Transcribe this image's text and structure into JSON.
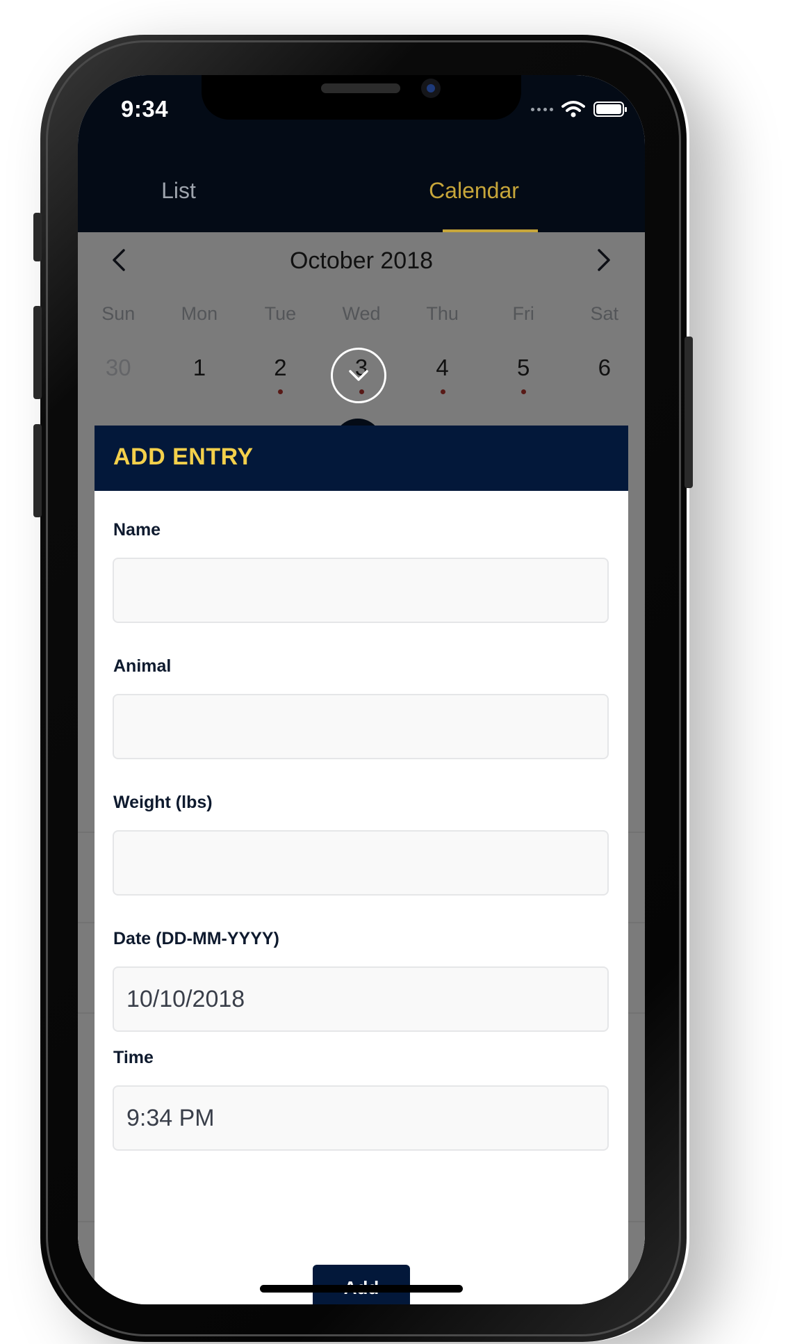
{
  "status_bar": {
    "time": "9:34"
  },
  "tabs": [
    {
      "label": "List",
      "active": false
    },
    {
      "label": "Calendar",
      "active": true
    }
  ],
  "calendar": {
    "month": "October 2018",
    "weekdays": [
      "Sun",
      "Mon",
      "Tue",
      "Wed",
      "Thu",
      "Fri",
      "Sat"
    ],
    "days": [
      {
        "label": "30",
        "muted": true,
        "dot": false
      },
      {
        "label": "1",
        "muted": false,
        "dot": false
      },
      {
        "label": "2",
        "muted": false,
        "dot": true
      },
      {
        "label": "3",
        "muted": false,
        "dot": true
      },
      {
        "label": "4",
        "muted": false,
        "dot": true
      },
      {
        "label": "5",
        "muted": false,
        "dot": true
      },
      {
        "label": "6",
        "muted": false,
        "dot": false
      }
    ]
  },
  "modal": {
    "title": "ADD ENTRY",
    "fields": {
      "name": {
        "label": "Name",
        "value": ""
      },
      "animal": {
        "label": "Animal",
        "value": ""
      },
      "weight": {
        "label": "Weight (lbs)",
        "value": ""
      },
      "date": {
        "label": "Date (DD-MM-YYYY)",
        "value": "10/10/2018"
      },
      "time": {
        "label": "Time",
        "value": "9:34 PM"
      }
    },
    "add_label": "Add"
  },
  "colors": {
    "header_bg": "#040b16",
    "modal_header_bg": "#03183a",
    "accent_gold": "#c7a63a",
    "title_yellow": "#f4d04b",
    "event_dot": "#b1322d"
  }
}
